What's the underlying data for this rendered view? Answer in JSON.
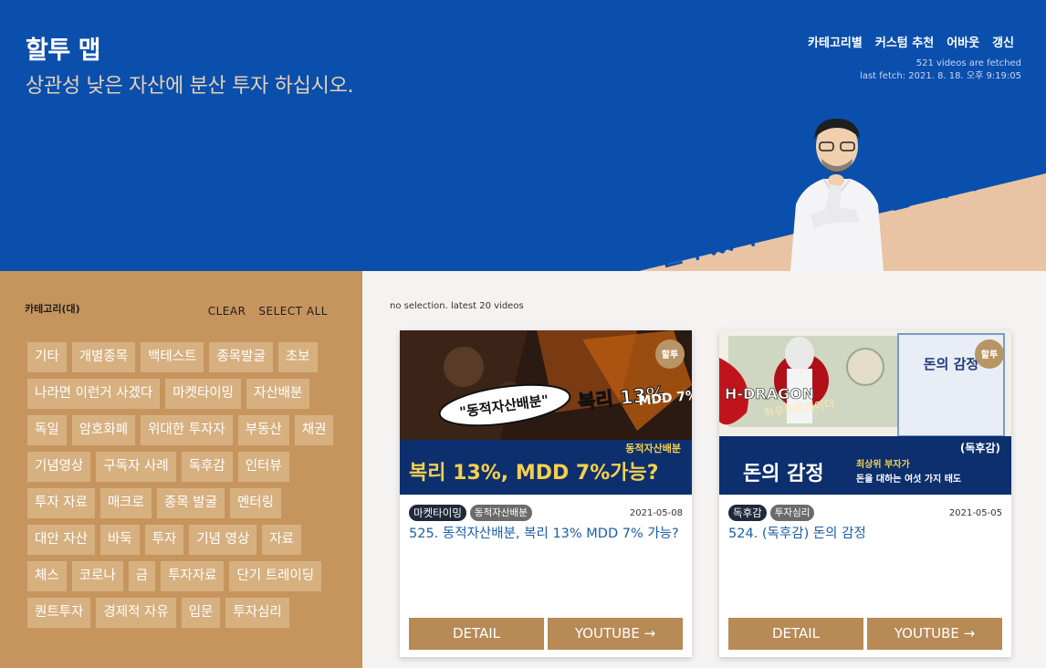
{
  "header": {
    "title": "할투 맵",
    "subtitle": "상관성 낮은 자산에 분산 투자 하십시오.",
    "nav": [
      "카테고리별",
      "커스텀 추천",
      "어바웃",
      "갱신"
    ],
    "fetched_count": "521 videos are fetched",
    "last_fetch": "last fetch: 2021. 8. 18. 오후 9:19:05",
    "banner_left": "할수있다",
    "banner_right": "알고투자"
  },
  "sidebar": {
    "heading": "카테고리(대)",
    "clear_label": "CLEAR",
    "select_all_label": "SELECT ALL",
    "tags": [
      "기타",
      "개별종목",
      "백테스트",
      "종목발굴",
      "초보",
      "나라면 이런거 사겠다",
      "마켓타이밍",
      "자산배분",
      "독일",
      "암호화폐",
      "위대한 투자자",
      "부동산",
      "채권",
      "기념영상",
      "구독자 사례",
      "독후감",
      "인터뷰",
      "투자 자료",
      "매크로",
      "종목 발굴",
      "멘터링",
      "대안 자산",
      "바둑",
      "투자",
      "기념 영상",
      "자료",
      "체스",
      "코로나",
      "금",
      "투자자료",
      "단기 트레이딩",
      "퀀트투자",
      "경제적 자유",
      "입문",
      "투자심리"
    ]
  },
  "main": {
    "status": "no selection. latest 20 videos",
    "cards": [
      {
        "badges": [
          "마켓타이밍",
          "동적자산배분"
        ],
        "date": "2021-05-08",
        "title": "525. 동적자산배분, 복리 13% MDD 7% 가능?",
        "detail_label": "DETAIL",
        "youtube_label": "YOUTUBE →",
        "thumb": {
          "corner": "할투",
          "bubble": "\"동적자산배분\"",
          "big": "복리 13%",
          "mdd": "MDD 7%",
          "tag": "동적자산배분",
          "headline": "복리 13%, MDD 7%가능?"
        }
      },
      {
        "badges": [
          "독후감",
          "투자심리"
        ],
        "date": "2021-05-05",
        "title": "524. (독후감) 돈의 감정",
        "detail_label": "DETAIL",
        "youtube_label": "YOUTUBE →",
        "thumb": {
          "corner": "할투",
          "book": "돈의 감정",
          "name": "H-DRAGON",
          "script": "하우투트레이더",
          "tag": "(독후감)",
          "headline": "돈의 감정",
          "sub1": "최상위 부자가",
          "sub2": "돈을 대하는 여섯 가지 태도"
        }
      }
    ]
  },
  "colors": {
    "header_bg": "#0b4fad",
    "sidebar_bg": "#c6955e",
    "tag_bg": "#d7b080",
    "button_bg": "#b78a56",
    "link": "#1a5ea8"
  }
}
